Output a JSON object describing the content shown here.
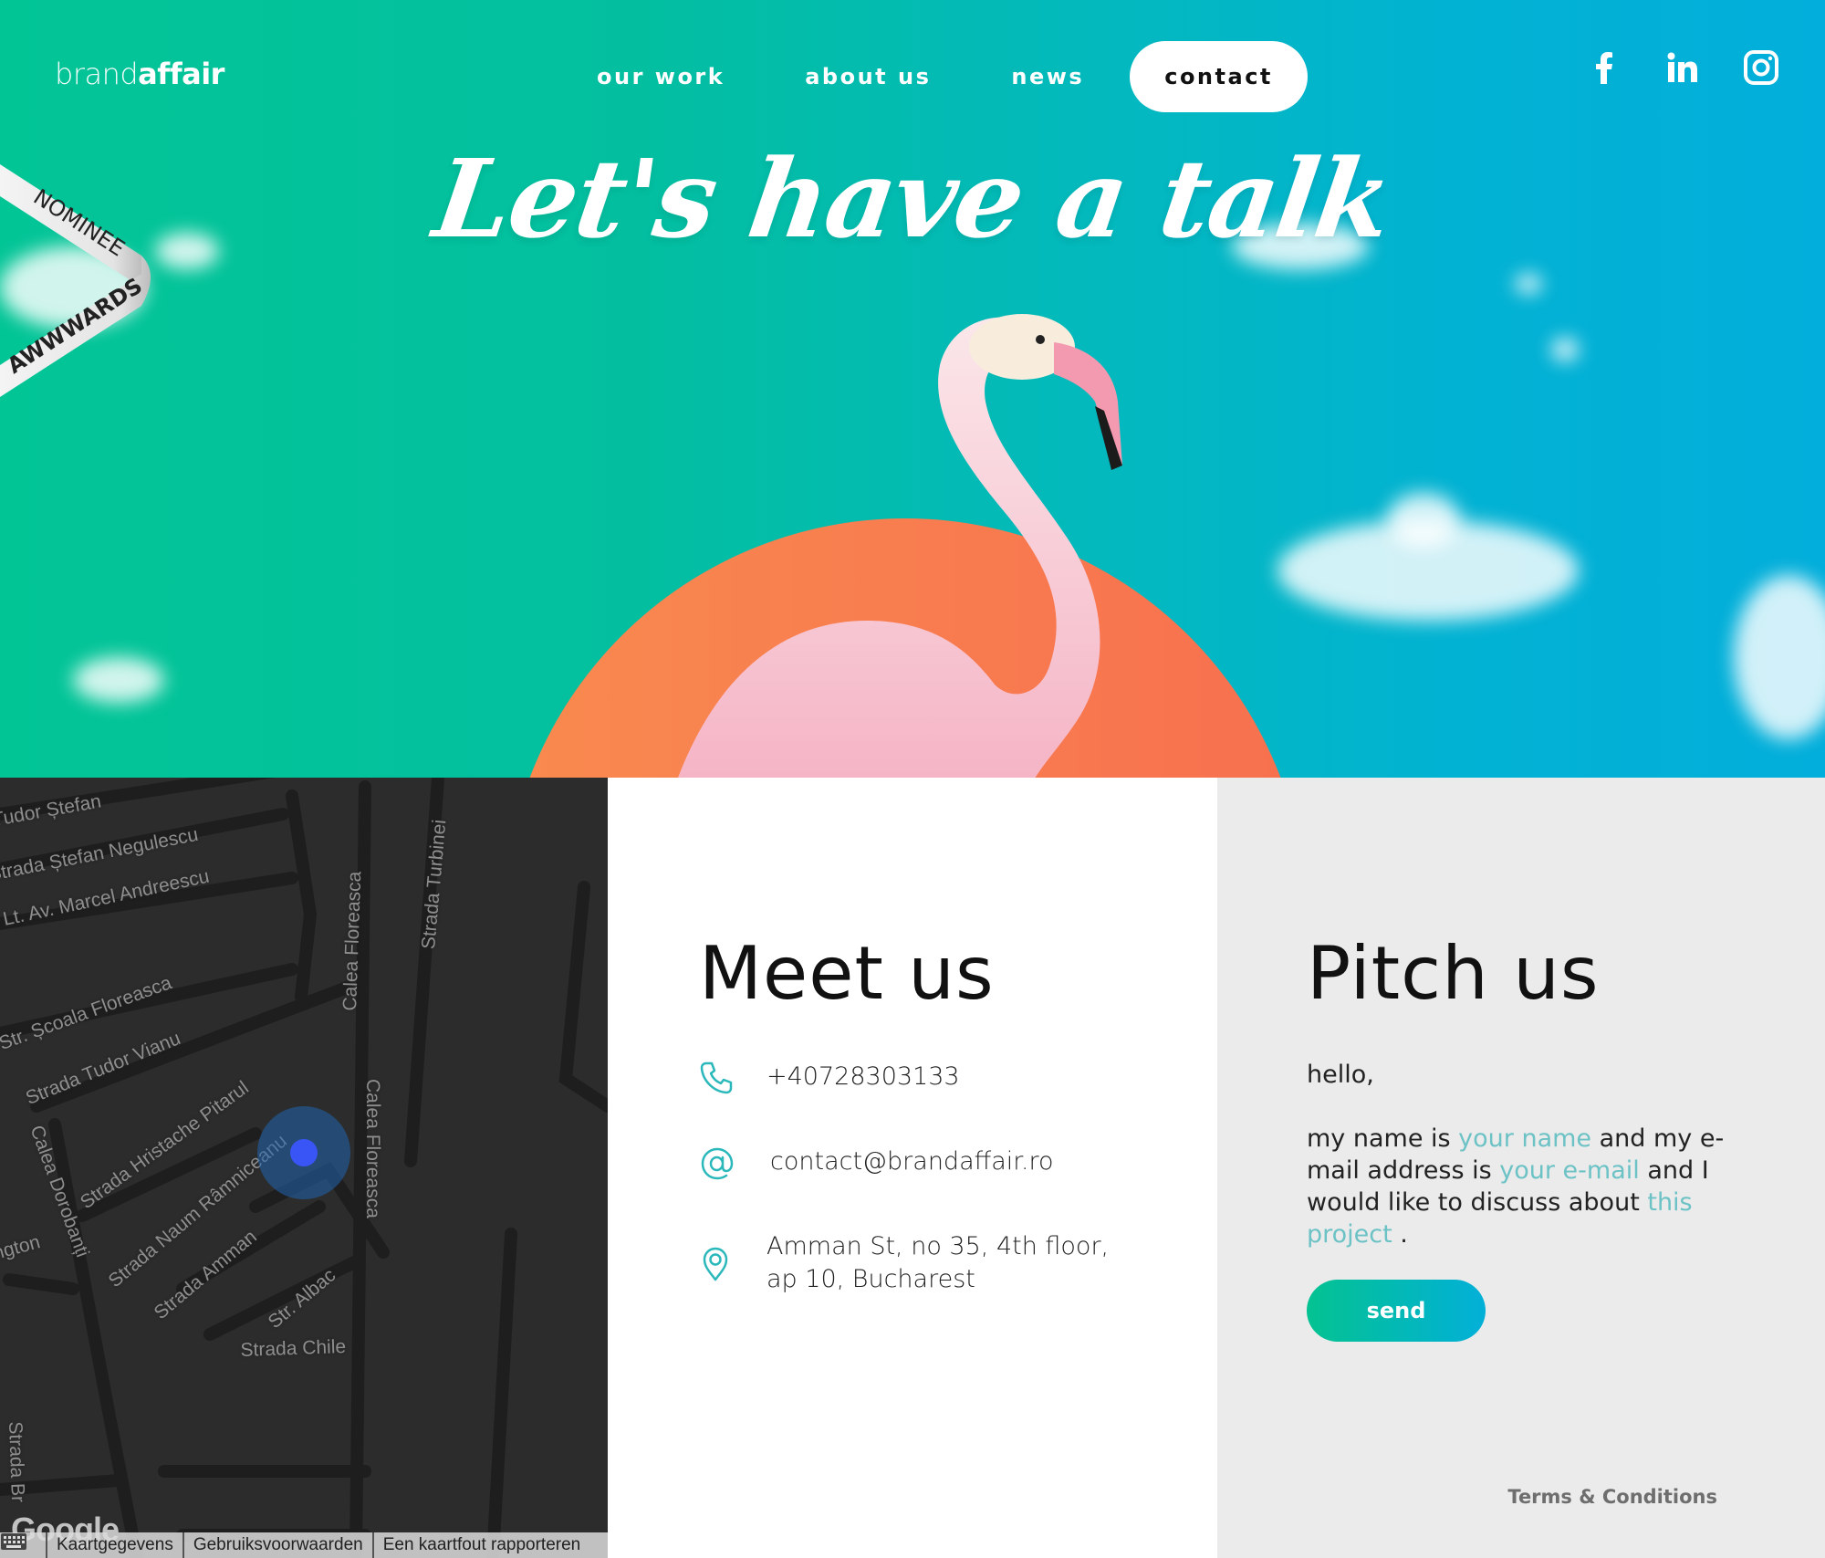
{
  "header": {
    "logo_light": "brand",
    "logo_bold": "affair",
    "nav": [
      {
        "label": "our work",
        "active": false
      },
      {
        "label": "about us",
        "active": false
      },
      {
        "label": "news",
        "active": false
      },
      {
        "label": "contact",
        "active": true
      }
    ],
    "social": [
      "facebook-icon",
      "linkedin-icon",
      "instagram-icon"
    ]
  },
  "hero": {
    "headline": "Let's have a talk",
    "award_line1": "NOMINEE",
    "award_line2": "AWWWARDS"
  },
  "map": {
    "streets": [
      "Tudor Ștefan",
      "Strada Ștefan Negulescu",
      "Strada Lt. Av. Marcel Andreescu",
      "Str. Școala Floreasca",
      "Strada Tudor Vianu",
      "Strada Hristache Pitarul",
      "Strada Naum Râmniceanu",
      "Strada Amman",
      "Str. Albac",
      "Strada Chile",
      "Calea Floreasca",
      "Calea Floreasca",
      "Strada Turbinei",
      "Calea Dorobanți",
      "ngton",
      "Strada Br"
    ],
    "google_logo": "Google",
    "attribution": [
      "Kaartgegevens",
      "Gebruiksvoorwaarden",
      "Een kaartfout rapporteren"
    ]
  },
  "meet": {
    "title": "Meet us",
    "phone": "+40728303133",
    "email": "contact@brandaffair.ro",
    "address_line1": "Amman St, no 35, 4th floor,",
    "address_line2": "ap 10, Bucharest"
  },
  "pitch": {
    "title": "Pitch us",
    "hello": "hello,",
    "text1": "my name is ",
    "name_placeholder": "your name",
    "text2": " and my e-mail address is ",
    "email_placeholder": "your e-mail",
    "text3": " and I would like to discuss about ",
    "project_placeholder": "this project",
    "text4": " .",
    "send_label": "send",
    "terms": "Terms & Conditions"
  },
  "colors": {
    "accent_green": "#02c596",
    "accent_blue": "#02aedb",
    "sun_orange": "#f7704f",
    "field_teal": "#6cc2c5"
  }
}
